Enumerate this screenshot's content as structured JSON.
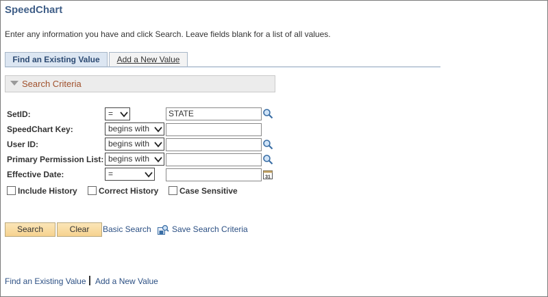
{
  "page": {
    "title": "SpeedChart",
    "instructions": "Enter any information you have and click Search. Leave fields blank for a list of all values."
  },
  "tabs": [
    {
      "label": "Find an Existing Value",
      "active": true
    },
    {
      "label": "Add a New Value",
      "active": false
    }
  ],
  "criteria": {
    "header": "Search Criteria",
    "fields": [
      {
        "label": "SetID:",
        "operator": "=",
        "value": "STATE",
        "lookup": true
      },
      {
        "label": "SpeedChart Key:",
        "operator": "begins with",
        "value": "",
        "lookup": false
      },
      {
        "label": "User ID:",
        "operator": "begins with",
        "value": "",
        "lookup": true
      },
      {
        "label": "Primary Permission List:",
        "operator": "begins with",
        "value": "",
        "lookup": true
      },
      {
        "label": "Effective Date:",
        "operator": "=",
        "value": "",
        "calendar": true,
        "calendar_text": "31"
      }
    ],
    "checkboxes": [
      {
        "label": "Include History",
        "checked": false
      },
      {
        "label": "Correct History",
        "checked": false
      },
      {
        "label": "Case Sensitive",
        "checked": false
      }
    ]
  },
  "actions": {
    "search_label": "Search",
    "clear_label": "Clear",
    "basic_search_label": "Basic Search",
    "save_criteria_label": "Save Search Criteria"
  },
  "footer_links": [
    "Find an Existing Value",
    "Add a New Value"
  ],
  "icons": {
    "lookup": "magnifier-icon",
    "calendar": "calendar-icon",
    "save": "save-search-icon",
    "dropdown": "chevron-down-icon"
  },
  "colors": {
    "title": "#3f5e87",
    "link": "#2b4f83",
    "tab_active": "#dce6f2",
    "button": "#f6d28f",
    "criteria_header": "#a0502b"
  }
}
